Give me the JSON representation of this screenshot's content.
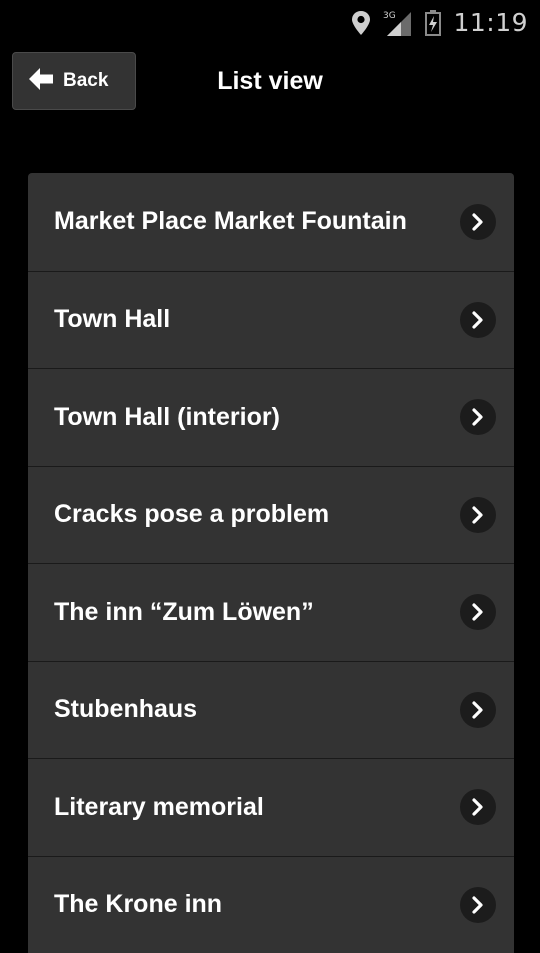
{
  "status_bar": {
    "network": "3G",
    "time": "11:19",
    "icons": [
      "location-pin-icon",
      "signal-icon",
      "battery-icon"
    ]
  },
  "header": {
    "back_label": "Back",
    "title": "List view"
  },
  "list": {
    "items": [
      {
        "label": "Market Place Market Fountain"
      },
      {
        "label": "Town Hall"
      },
      {
        "label": "Town Hall (interior)"
      },
      {
        "label": "Cracks pose a problem"
      },
      {
        "label": "The inn “Zum Löwen”"
      },
      {
        "label": "Stubenhaus"
      },
      {
        "label": "Literary memorial"
      },
      {
        "label": "The Krone inn"
      }
    ]
  },
  "colors": {
    "background": "#000000",
    "list_bg": "#333333",
    "chevron_bg": "#1c1c1c",
    "text": "#ffffff"
  }
}
